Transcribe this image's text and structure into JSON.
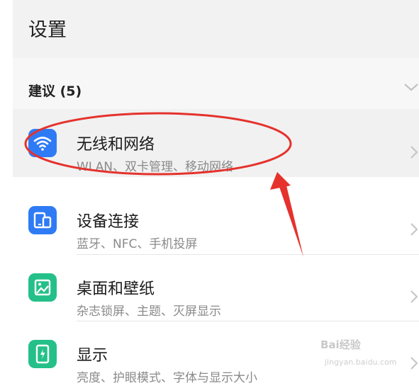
{
  "header": {
    "title": "设置"
  },
  "suggestions": {
    "label": "建议 (5)",
    "chevron_icon": "chevron-down-icon"
  },
  "items": [
    {
      "title": "无线和网络",
      "subtitle": "WLAN、双卡管理、移动网络",
      "icon": "wifi-icon",
      "color": "#2f7bf5"
    },
    {
      "title": "设备连接",
      "subtitle": "蓝牙、NFC、手机投屏",
      "icon": "device-connect-icon",
      "color": "#2f7bf5"
    },
    {
      "title": "桌面和壁纸",
      "subtitle": "杂志锁屏、主题、灭屏显示",
      "icon": "wallpaper-icon",
      "color": "#25c08a"
    },
    {
      "title": "显示",
      "subtitle": "亮度、护眼模式、字体与显示大小",
      "icon": "display-icon",
      "color": "#25c08a"
    }
  ],
  "annotation": {
    "shape": "red-ellipse-with-arrow",
    "color": "#e5322d"
  },
  "watermark": {
    "text": "Bai经验",
    "sub": "jingyan.baidu.com"
  }
}
